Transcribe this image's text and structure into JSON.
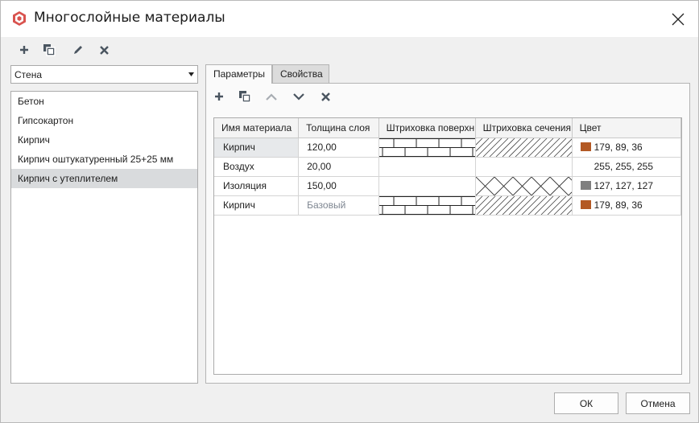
{
  "window": {
    "title": "Многослойные материалы"
  },
  "toolbar": {
    "icons": [
      "plus-icon",
      "copy-icon",
      "pencil-icon",
      "delete-x-icon"
    ]
  },
  "type_select": {
    "value": "Стена"
  },
  "materials_list": [
    {
      "label": "Бетон",
      "selected": false
    },
    {
      "label": "Гипсокартон",
      "selected": false
    },
    {
      "label": "Кирпич",
      "selected": false
    },
    {
      "label": "Кирпич оштукатуренный 25+25 мм",
      "selected": false
    },
    {
      "label": "Кирпич с утеплителем",
      "selected": true
    }
  ],
  "tabs": [
    {
      "label": "Параметры",
      "active": true
    },
    {
      "label": "Свойства",
      "active": false
    }
  ],
  "layers_toolbar": {
    "icons": [
      "plus-icon",
      "copy-icon",
      "move-up-icon",
      "move-down-icon",
      "delete-x-icon"
    ]
  },
  "layers_table": {
    "columns": [
      "Имя материала",
      "Толщина слоя",
      "Штриховка поверхн",
      "Штриховка сечения",
      "Цвет"
    ],
    "rows": [
      {
        "name": "Кирпич",
        "thickness": "120,00",
        "surface_hatch": "brick",
        "section_hatch": "diagonal",
        "color": "179, 89, 36",
        "color_hex": "#b35924",
        "selected": true
      },
      {
        "name": "Воздух",
        "thickness": "20,00",
        "surface_hatch": "none",
        "section_hatch": "none",
        "color": "255, 255, 255",
        "color_hex": "#ffffff",
        "selected": false
      },
      {
        "name": "Изоляция",
        "thickness": "150,00",
        "surface_hatch": "none",
        "section_hatch": "crosshatch",
        "color": "127, 127, 127",
        "color_hex": "#7f7f7f",
        "selected": false
      },
      {
        "name": "Кирпич",
        "thickness": "Базовый",
        "surface_hatch": "brick",
        "section_hatch": "diagonal",
        "color": "179, 89, 36",
        "color_hex": "#b35924",
        "selected": false
      }
    ]
  },
  "buttons": {
    "ok": "ОК",
    "cancel": "Отмена"
  },
  "colors": {
    "icon_gray": "#4a5560",
    "icon_disabled": "#a8adb3",
    "brand_red": "#d9534f"
  }
}
